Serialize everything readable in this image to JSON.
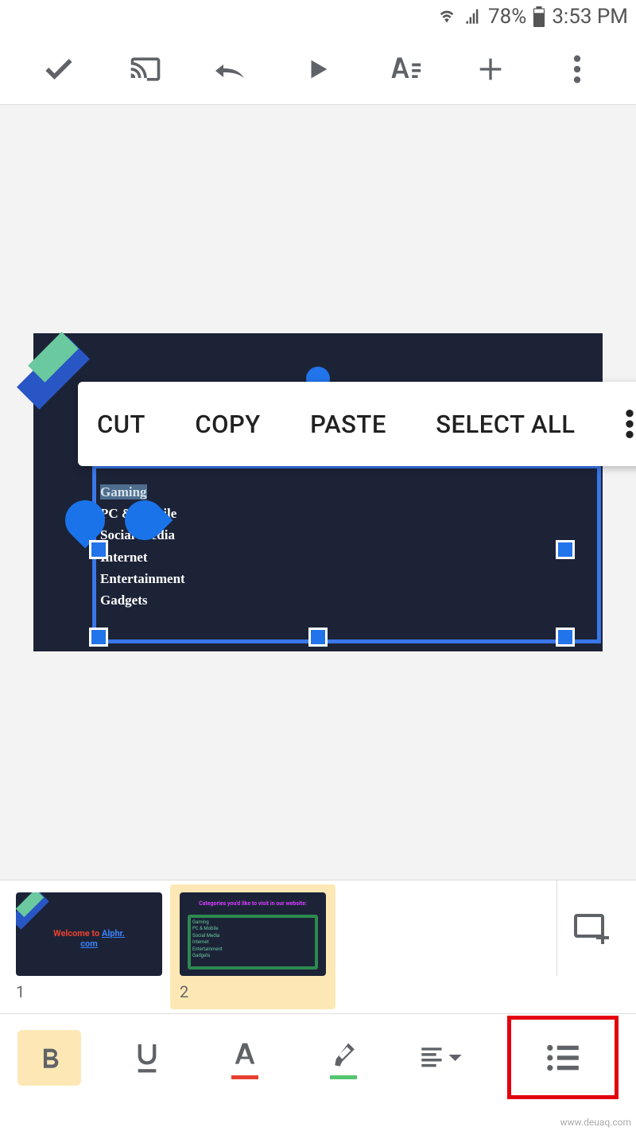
{
  "status": {
    "battery": "78%",
    "time": "3:53 PM"
  },
  "context_menu": {
    "items": [
      "CUT",
      "COPY",
      "PASTE",
      "SELECT ALL"
    ]
  },
  "slide_list": [
    "Gaming",
    "PC & Mobile",
    "Social Media",
    "Internet",
    "Entertainment",
    "Gadgets"
  ],
  "thumb1": {
    "text_red": "Welcome to ",
    "text_blue": "Alphr.",
    "text_blue2": "com"
  },
  "thumb2": {
    "title": "Categories you'd like to visit in our website:",
    "items": [
      "Gaming",
      "PC & Mobile",
      "Social Media",
      "Internet",
      "Entertainment",
      "Gadgets"
    ]
  },
  "thumbs": {
    "n1": "1",
    "n2": "2"
  },
  "watermark": "www.deuaq.com"
}
